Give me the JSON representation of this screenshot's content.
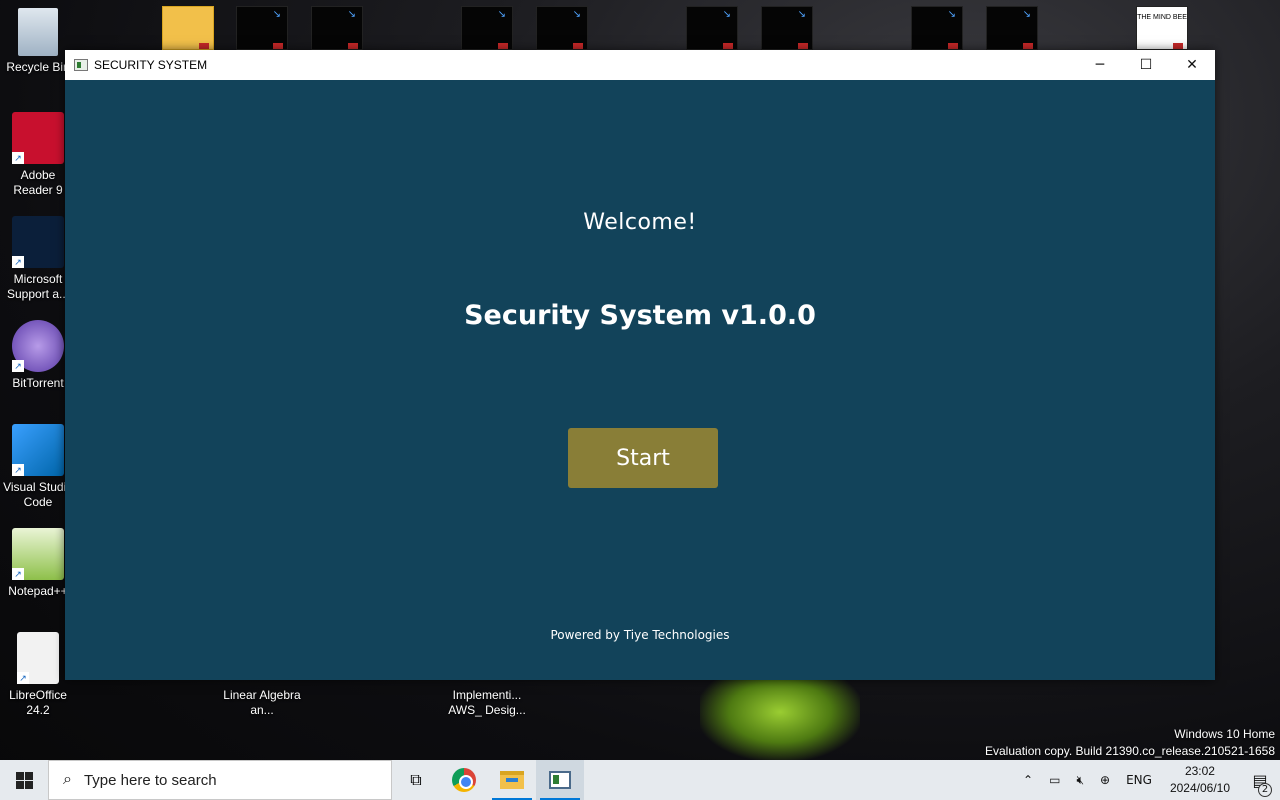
{
  "desktop": {
    "icons": [
      {
        "label": "Recycle Bin"
      },
      {
        "label": "Adobe Reader 9"
      },
      {
        "label": "Microsoft Support a..."
      },
      {
        "label": "BitTorrent"
      },
      {
        "label": "Visual Studio Code"
      },
      {
        "label": "Notepad++"
      },
      {
        "label": "LibreOffice 24.2"
      },
      {
        "label": "Linear Algebra an..."
      },
      {
        "label": "Implementi... AWS_ Desig..."
      }
    ],
    "thumb_text": "THE MIND BEE",
    "watermark": {
      "line1": "Windows 10 Home",
      "line2": "Evaluation copy. Build 21390.co_release.210521-1658"
    }
  },
  "window": {
    "title": "SECURITY SYSTEM",
    "controls": {
      "minimize": "─",
      "maximize": "☐",
      "close": "✕"
    },
    "welcome": "Welcome!",
    "app_title": "Security System v1.0.0",
    "start_label": "Start",
    "powered_by": "Powered by Tiye Technologies"
  },
  "taskbar": {
    "search_placeholder": "Type here to search",
    "language": "ENG",
    "time": "23:02",
    "date": "2024/06/10",
    "notification_count": "2"
  },
  "colors": {
    "window_bg": "#12435a",
    "start_button": "#897e37",
    "taskbar_bg": "#e6eaee"
  }
}
